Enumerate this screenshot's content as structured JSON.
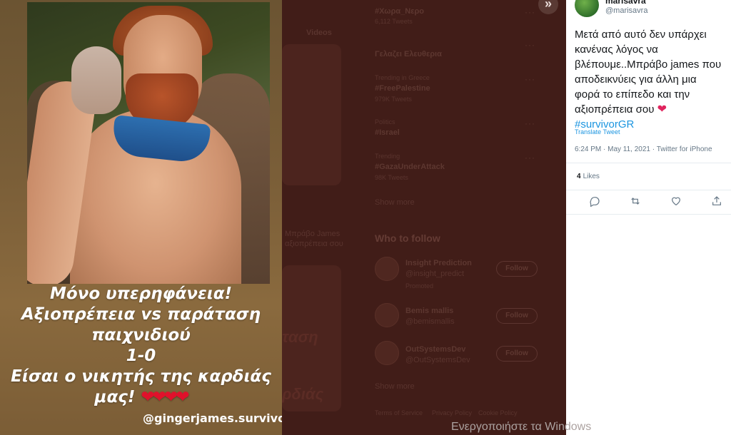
{
  "story": {
    "caption_lines": [
      "Μόνο υπερηφάνεια!",
      "Αξιοπρέπεια vs παράταση",
      "παιχνιδιού",
      "1-0",
      "Είσαι ο νικητής της καρδιάς",
      "μας!"
    ],
    "hearts": "❤❤❤❤",
    "handle": "@gingerjames.survivor"
  },
  "background": {
    "trend_1": "#Χωρα_Νερο",
    "trend_1_sub": "6,112 Tweets",
    "trend_2": "Γελαζει Ελευθερια",
    "trend_3_meta": "Trending in Greece",
    "trend_3": "#FreePalestine",
    "trend_3_sub": "979K Tweets",
    "trend_4_meta": "Politics",
    "trend_4": "#Israel",
    "trend_5_meta": "Trending",
    "trend_5": "#GazaUnderAttack",
    "trend_5_sub": "98K Tweets",
    "show_more": "Show more",
    "who_to_follow": "Who to follow",
    "follow_1_name": "Insight Prediction",
    "follow_1_user": "@insight_predict",
    "follow_1_promoted": "Promoted",
    "follow_2_name": "Bemis mallis",
    "follow_2_user": "@bemismallis",
    "follow_3_name": "OutSystemsDev",
    "follow_3_user": "@OutSystemsDev",
    "follow_label": "Follow",
    "show_more_2": "Show more",
    "footer_1": "Terms of Service",
    "footer_2": "Privacy Policy",
    "footer_3": "Cookie Policy",
    "videos_tab": "Videos",
    "ghost_text_1": "ταση",
    "ghost_text_2": "ρδιάς",
    "ghost_text_3": "Μπράβο James",
    "ghost_text_4": "αξιοπρέπεια σου"
  },
  "tweet": {
    "name": "marisavra",
    "username": "@marisavra",
    "text_lines": [
      "Μετά από αυτό δεν υπάρχει",
      "κανένας λόγος να",
      "βλέπουμε..Μπράβο james που",
      "αποδεικνύεις για άλλη μια",
      "φορά το επίπεδο και την",
      "αξιοπρέπεια σου"
    ],
    "heart": "❤",
    "hashtag": "#survivorGR",
    "translate": "Translate Tweet",
    "meta": "6:24 PM · May 11, 2021 · Twitter for iPhone",
    "likes_count": "4",
    "likes_label": "Likes"
  },
  "icons": [
    "close-chevron-icon",
    "reply-icon",
    "retweet-icon",
    "like-icon",
    "share-icon"
  ],
  "watermark": "Ενεργοποιήστε τα Windows"
}
